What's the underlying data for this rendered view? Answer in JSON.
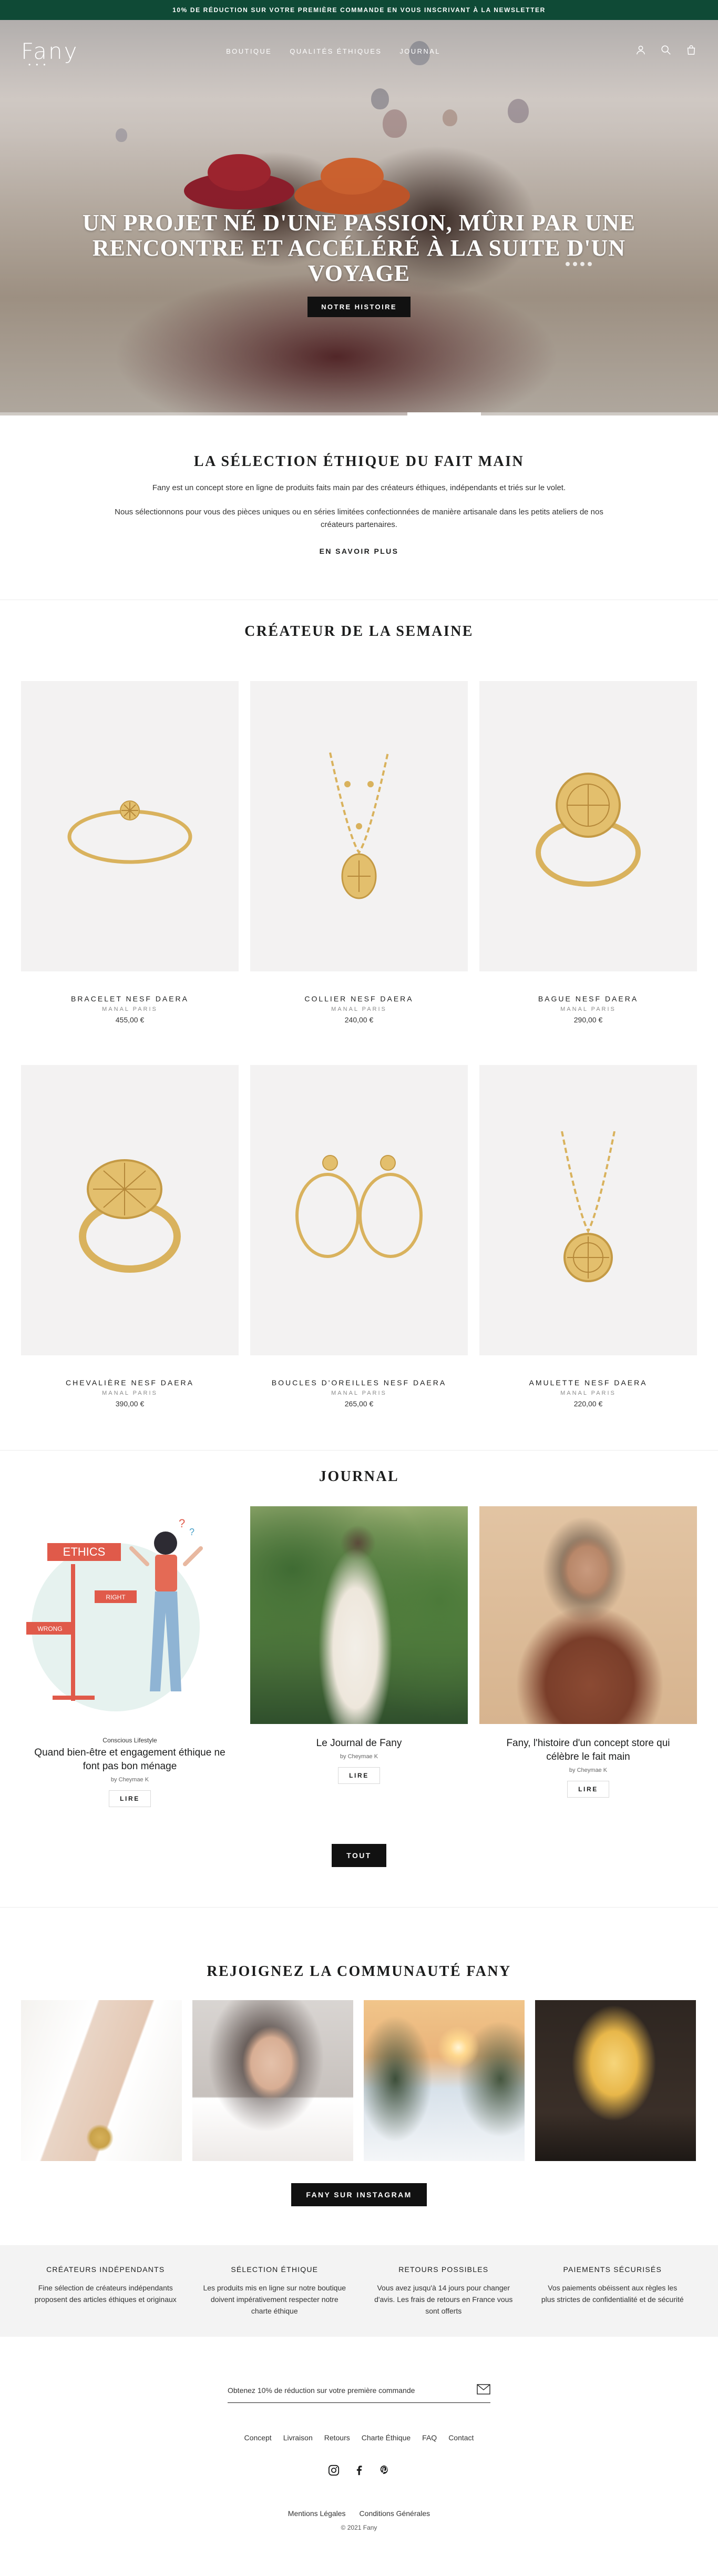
{
  "announcement": "10% DE RÉDUCTION SUR VOTRE PREMIÈRE COMMANDE EN VOUS INSCRIVANT À LA NEWSLETTER",
  "header": {
    "logo": "Fany",
    "nav": [
      "BOUTIQUE",
      "QUALITÉS ÉTHIQUES",
      "JOURNAL"
    ],
    "icons": [
      "account-icon",
      "search-icon",
      "cart-icon"
    ]
  },
  "hero": {
    "title": "UN PROJET NÉ D'UNE PASSION, MÛRI PAR UNE RENCONTRE ET ACCÉLÉRÉ À LA SUITE D'UN VOYAGE",
    "button": "NOTRE HISTOIRE"
  },
  "intro": {
    "title": "LA SÉLECTION ÉTHIQUE DU FAIT MAIN",
    "p1": "Fany est un concept store en ligne de produits faits main par des créateurs éthiques, indépendants et triés sur le volet.",
    "p2": "Nous sélectionnons pour vous des pièces uniques ou en séries limitées confectionnées de manière artisanale dans les petits ateliers de nos créateurs partenaires.",
    "link": "EN SAVOIR PLUS"
  },
  "products": {
    "title": "CRÉATEUR DE LA SEMAINE",
    "items": [
      {
        "name": "BRACELET NESF DAERA",
        "vendor": "MANAL PARIS",
        "price": "455,00 €",
        "icon": "bracelet"
      },
      {
        "name": "COLLIER NESF DAERA",
        "vendor": "MANAL PARIS",
        "price": "240,00 €",
        "icon": "necklace"
      },
      {
        "name": "BAGUE NESF DAERA",
        "vendor": "MANAL PARIS",
        "price": "290,00 €",
        "icon": "ring"
      },
      {
        "name": "CHEVALIÈRE NESF DAERA",
        "vendor": "MANAL PARIS",
        "price": "390,00 €",
        "icon": "signet-ring"
      },
      {
        "name": "BOUCLES D'OREILLES NESF DAERA",
        "vendor": "MANAL PARIS",
        "price": "265,00 €",
        "icon": "earrings"
      },
      {
        "name": "AMULETTE NESF DAERA",
        "vendor": "MANAL PARIS",
        "price": "220,00 €",
        "icon": "amulet"
      }
    ]
  },
  "journal": {
    "title": "JOURNAL",
    "articles": [
      {
        "tag": "Conscious Lifestyle",
        "title": "Quand bien-être et engagement éthique ne font pas bon ménage",
        "by": "by Cheymae K",
        "button": "LIRE",
        "image_text": [
          "ETHICS",
          "RIGHT",
          "WRONG"
        ]
      },
      {
        "tag": "",
        "title": "Le Journal de Fany",
        "by": "by Cheymae K",
        "button": "LIRE"
      },
      {
        "tag": "",
        "title": "Fany, l'histoire d'un concept store qui célèbre le fait main",
        "by": "by Cheymae K",
        "button": "LIRE"
      }
    ],
    "all_button": "TOUT"
  },
  "instagram": {
    "title": "REJOIGNEZ LA COMMUNAUTÉ FANY",
    "button": "FANY SUR INSTAGRAM"
  },
  "features": [
    {
      "title": "CRÉATEURS INDÉPENDANTS",
      "text": "Fine sélection de créateurs indépendants proposent des articles éthiques et originaux"
    },
    {
      "title": "SÉLECTION ÉTHIQUE",
      "text": "Les produits mis en ligne sur notre boutique doivent impérativement respecter notre charte éthique"
    },
    {
      "title": "RETOURS POSSIBLES",
      "text": "Vous avez jusqu'à 14 jours pour changer d'avis. Les frais de retours en France vous sont offerts"
    },
    {
      "title": "PAIEMENTS SÉCURISÉS",
      "text": "Vos paiements obéissent aux règles les plus strictes de confidentialité et de sécurité"
    }
  ],
  "footer": {
    "newsletter_placeholder": "Obtenez 10% de réduction sur votre première commande",
    "links": [
      "Concept",
      "Livraison",
      "Retours",
      "Charte Éthique",
      "FAQ",
      "Contact"
    ],
    "social": [
      "instagram-icon",
      "facebook-icon",
      "pinterest-icon"
    ],
    "legal": [
      "Mentions Légales",
      "Conditions Générales"
    ],
    "copyright": "© 2021 Fany"
  },
  "colors": {
    "announcement_bg": "#0f4a36",
    "button_bg": "#111111",
    "gold": "#d9b25d",
    "feature_bg": "#f3f3f3"
  }
}
